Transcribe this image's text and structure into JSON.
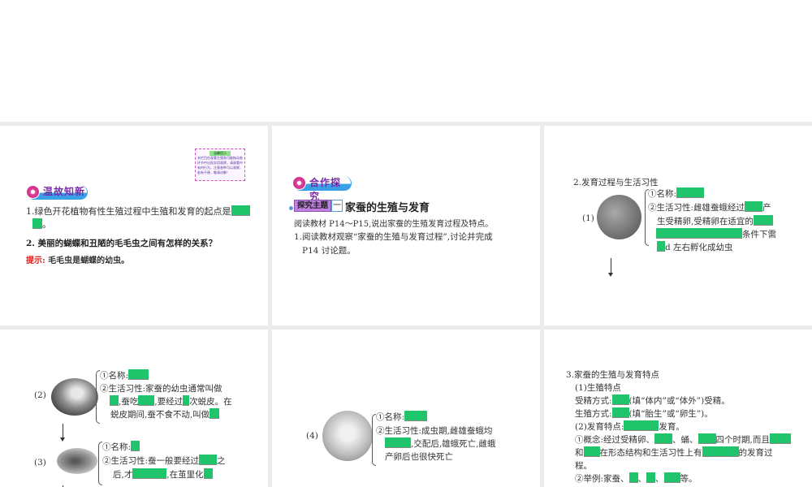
{
  "panel1": {
    "tip_title": "温馨提示",
    "tip_body": "本栏目在观看生殖和可能拖动各环节中出现实用观察，请观看中有何行为，注意各种可以观察，若有不便，敬请谅解！",
    "banner": "温故知新",
    "q1": "1.绿色开花植物有性生殖过程中生殖和发育的起点是",
    "q1_end": "。",
    "q2": "2. 美丽的蝴蝶和丑陋的毛毛虫之间有怎样的关系？",
    "hint_label": "提示:",
    "hint_text": "毛毛虫是蝴蝶的幼虫。"
  },
  "panel2": {
    "banner": "合作探究",
    "theme_label": "探究主题",
    "theme_num": "一",
    "theme_title": "家蚕的生殖与发育",
    "p1": "阅读教材 P14～P15,说出家蚕的生殖发育过程及特点。",
    "p2": "1.阅读教材观察“家蚕的生殖与发育过程”,讨论并完成",
    "p3": "P14 讨论题。"
  },
  "panel3": {
    "heading": "2.发育过程与生活习性",
    "stage": "(1)",
    "l1": "①名称:",
    "l2a": "②生活习性:雌雄蚕蛾经过",
    "l2b": "产",
    "l3": "生受精卵,受精卵在适宜的",
    "l4": "条件下需",
    "l5": "d 左右孵化成幼虫"
  },
  "panel4": {
    "stage2": "(2)",
    "s2l1": "①名称:",
    "s2l2": "②生活习性:家蚕的幼虫通常叫做",
    "s2l3a": ",蚕吃",
    "s2l3b": ",要经过",
    "s2l3c": "次蜕皮。在",
    "s2l4": "蜕皮期间,蚕不食不动,叫做",
    "stage3": "(3)",
    "s3l1": "①名称:",
    "s3l2a": "②生活习性:蚕一般要经过",
    "s3l2b": "之",
    "s3l3a": "后,才",
    "s3l3b": ",在茧里化"
  },
  "panel5": {
    "stage": "(4)",
    "l1": "①名称:",
    "l2": "②生活习性:成虫期,雌雄蚕蛾均",
    "l3": ",交配后,雄蛾死亡,雌蛾",
    "l4": "产卵后也很快死亡"
  },
  "panel6": {
    "heading": "3.家蚕的生殖与发育特点",
    "sub1": "(1)生殖特点",
    "fert_label": "受精方式:",
    "fert_note": "(填“体内”或“体外”)受精。",
    "repro_label": "生殖方式:",
    "repro_note": "(填“胎生”或“卵生”)。",
    "sub2a": "(2)发育特点:",
    "sub2b": "发育。",
    "c1a": "①概念:经过受精卵、",
    "c1b": "、蛹、",
    "c1c": "四个时期,而且",
    "c2a": "和",
    "c2b": "在形态结构和生活习性上有",
    "c2c": "的发育过",
    "c3": "程。",
    "ex_a": "②举例:家蚕、",
    "ex_b": "等。"
  },
  "colors": {
    "blank": "#20c46b",
    "banner": "#3aa0e8",
    "hint": "#e02020",
    "theme": "#b070d8"
  }
}
